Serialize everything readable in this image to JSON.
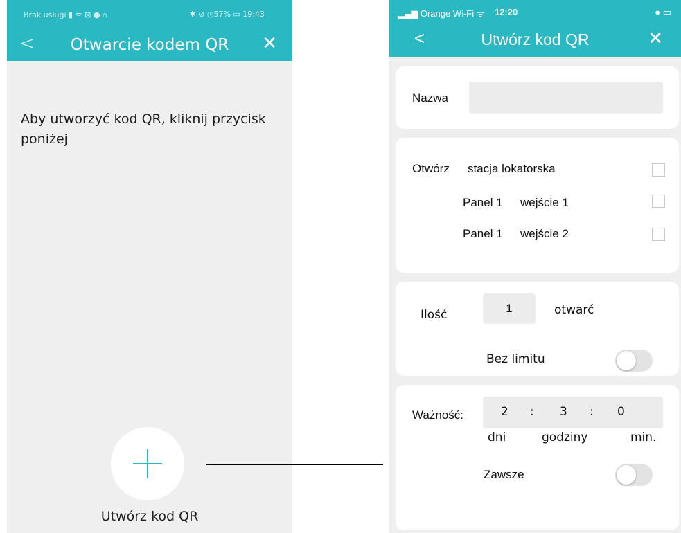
{
  "left": {
    "status": {
      "left_text": "Brak usługi ▮ ᯤ ⊠ ● ⌂",
      "right_text": "✱ ⊘ ◷57% ▭ 19:43"
    },
    "nav": {
      "back": "<",
      "title": "Otwarcie kodem QR",
      "close": "✕"
    },
    "instruction": "Aby utworzyć kod QR, kliknij przycisk poniżej",
    "create_button_label": "Utwórz kod QR"
  },
  "right": {
    "status": {
      "carrier": "Orange Wi-Fi",
      "time": "12:20"
    },
    "nav": {
      "back": "<",
      "title": "Utwórz kod QR",
      "close": "✕"
    },
    "name_label": "Nazwa",
    "name_value": "",
    "open_label": "Otwórz",
    "entries": [
      {
        "panel": "",
        "entry": "stacja lokatorska"
      },
      {
        "panel": "Panel 1",
        "entry": "wejście 1"
      },
      {
        "panel": "Panel 1",
        "entry": "wejście 2"
      }
    ],
    "quantity_label": "Ilość",
    "quantity_value": "1",
    "quantity_unit": "otwarć",
    "no_limit_label": "Bez limitu",
    "validity_label": "Ważność:",
    "validity": {
      "days": "2",
      "sep1": ":",
      "hours": "3",
      "sep2": ":",
      "minutes": "0"
    },
    "validity_units": {
      "days": "dni",
      "hours": "godziny",
      "minutes": "min."
    },
    "always_label": "Zawsze"
  },
  "colors": {
    "accent": "#2ab8c2",
    "background": "#efefef"
  }
}
